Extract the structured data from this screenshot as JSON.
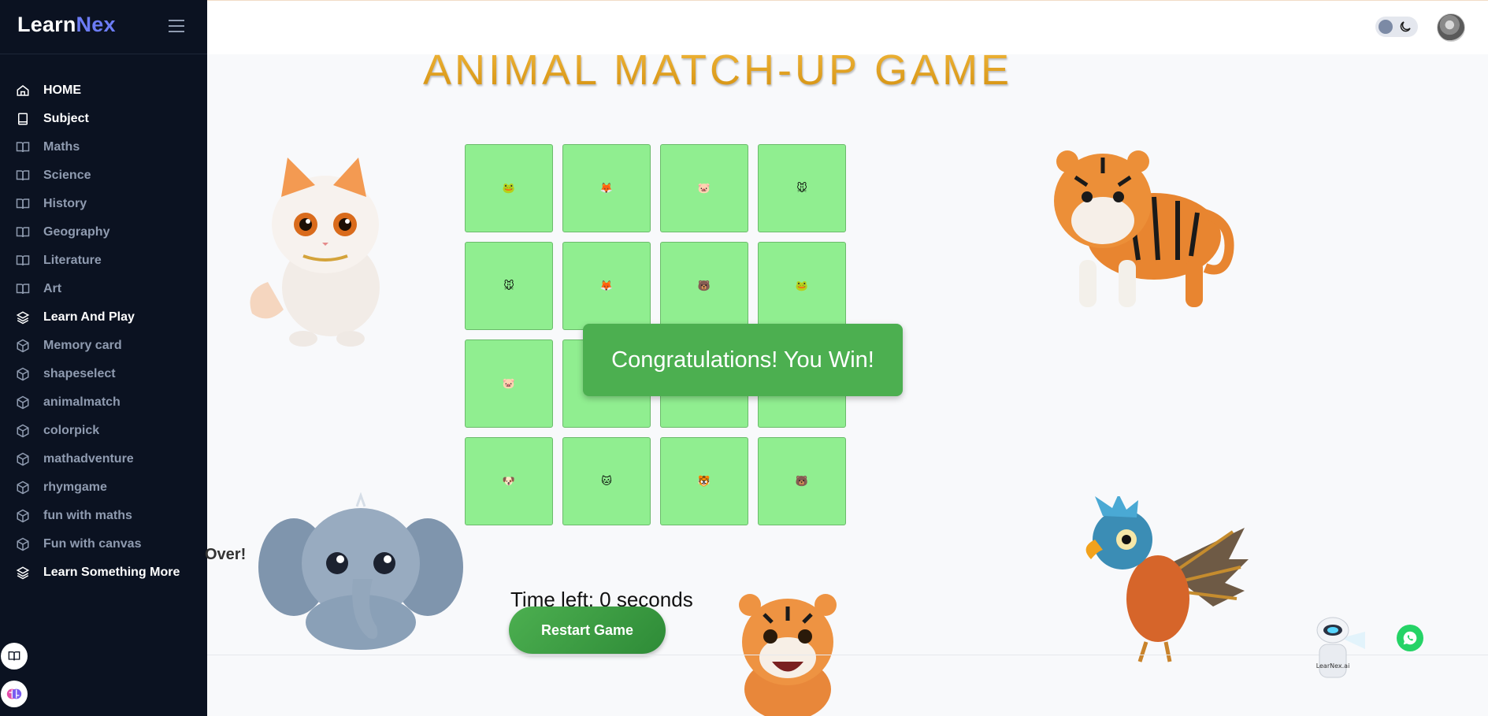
{
  "brand": {
    "part1": "Learn",
    "part2": "Nex",
    "accent_color": "#6c7cf5"
  },
  "sidebar": {
    "items": [
      {
        "label": "HOME",
        "icon": "home-icon",
        "strong": true
      },
      {
        "label": "Subject",
        "icon": "notebook-icon",
        "strong": true
      },
      {
        "label": "Maths",
        "icon": "book-open-icon",
        "strong": false
      },
      {
        "label": "Science",
        "icon": "book-open-icon",
        "strong": false
      },
      {
        "label": "History",
        "icon": "book-open-icon",
        "strong": false
      },
      {
        "label": "Geography",
        "icon": "book-open-icon",
        "strong": false
      },
      {
        "label": "Literature",
        "icon": "book-open-icon",
        "strong": false
      },
      {
        "label": "Art",
        "icon": "book-open-icon",
        "strong": false
      },
      {
        "label": "Learn And Play",
        "icon": "layers-icon",
        "strong": true
      },
      {
        "label": "Memory card",
        "icon": "cube-icon",
        "strong": false
      },
      {
        "label": "shapeselect",
        "icon": "cube-icon",
        "strong": false
      },
      {
        "label": "animalmatch",
        "icon": "cube-icon",
        "strong": false
      },
      {
        "label": "colorpick",
        "icon": "cube-icon",
        "strong": false
      },
      {
        "label": "mathadventure",
        "icon": "cube-icon",
        "strong": false
      },
      {
        "label": "rhymgame",
        "icon": "cube-icon",
        "strong": false
      },
      {
        "label": "fun with maths",
        "icon": "cube-icon",
        "strong": false
      },
      {
        "label": "Fun with canvas",
        "icon": "cube-icon",
        "strong": false
      },
      {
        "label": "Learn Something More",
        "icon": "layers-icon",
        "strong": true
      }
    ]
  },
  "game": {
    "title": "ANIMAL MATCH-UP GAME",
    "cards": [
      "🐸",
      "🦊",
      "🐷",
      "🐭",
      "🐭",
      "🦊",
      "🐻",
      "🐸",
      "🐷",
      "",
      "",
      "",
      "🐶",
      "🐱",
      "🐯",
      "🐻"
    ],
    "win_message": "Congratulations! You Win!",
    "time_left": "Time left: 0 seconds",
    "restart_label": "Restart Game",
    "over_fragment": "Over!"
  },
  "mascot": {
    "label": "LearNex.ai"
  },
  "colors": {
    "sidebar_bg": "#0b1221",
    "card_bg": "#90ee90",
    "popup_bg": "#4caf50",
    "title_gold": "#d79a14"
  }
}
